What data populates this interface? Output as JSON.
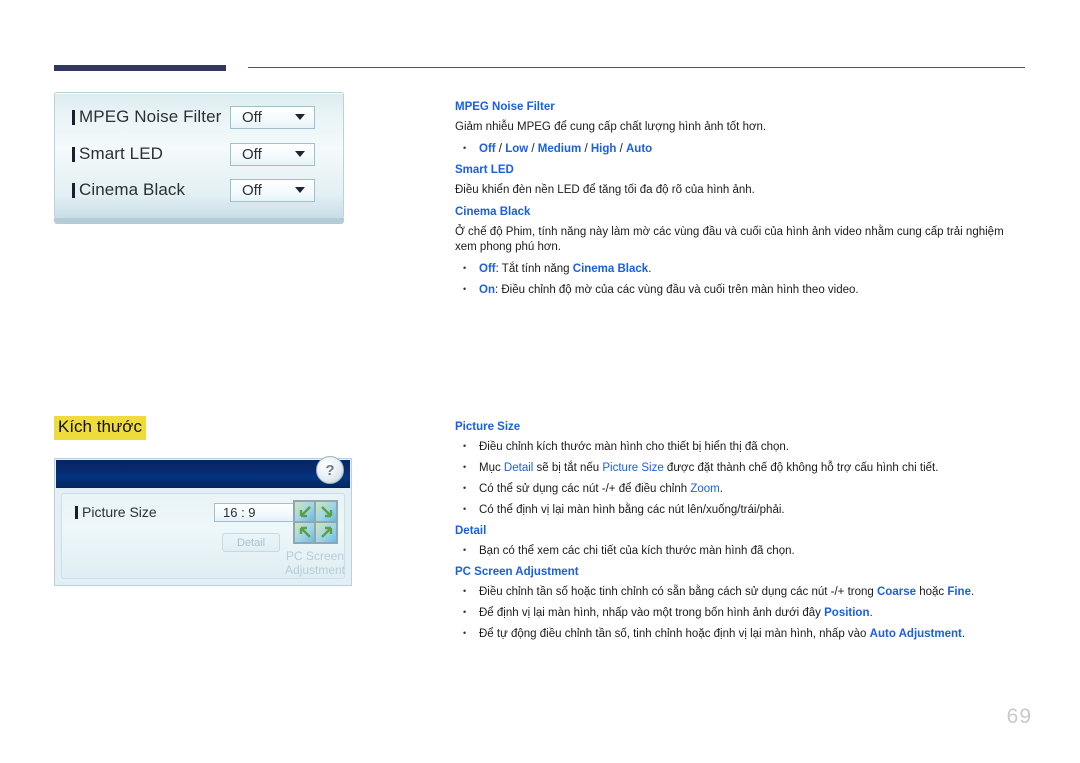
{
  "page": {
    "number": "69"
  },
  "osd_panel_picture": {
    "rows": [
      {
        "label": "MPEG Noise Filter",
        "value": "Off"
      },
      {
        "label": "Smart LED",
        "value": "Off"
      },
      {
        "label": "Cinema Black",
        "value": "Off"
      }
    ]
  },
  "section_heading": {
    "text": "Kích thước",
    "highlight_color": "#efdb3c"
  },
  "osd_panel_size": {
    "help_glyph": "?",
    "picture_size_label": "Picture Size",
    "picture_size_value": "16 : 9",
    "detail_button": "Detail",
    "pc_screen_adjustment_line1": "PC Screen",
    "pc_screen_adjustment_line2": "Adjustment"
  },
  "doc_top": {
    "sections": [
      {
        "title": "MPEG Noise Filter",
        "paragraphs": [
          "Giảm nhiễu MPEG để cung cấp chất lượng hình ảnh tốt hơn."
        ],
        "bullets_rich": [
          [
            {
              "t": "Off",
              "s": "b"
            },
            {
              "t": " / ",
              "s": "blk"
            },
            {
              "t": "Low",
              "s": "b"
            },
            {
              "t": " / ",
              "s": "blk"
            },
            {
              "t": "Medium",
              "s": "b"
            },
            {
              "t": " / ",
              "s": "blk"
            },
            {
              "t": "High",
              "s": "b"
            },
            {
              "t": " / ",
              "s": "blk"
            },
            {
              "t": "Auto",
              "s": "b"
            }
          ]
        ]
      },
      {
        "title": "Smart LED",
        "paragraphs": [
          "Điều khiển đèn nền LED để tăng tối đa độ rõ của hình ảnh."
        ],
        "bullets_rich": []
      },
      {
        "title": "Cinema Black",
        "paragraphs": [
          "Ở chế độ Phim, tính năng này làm mờ các vùng đầu và cuối của hình ảnh video nhằm cung cấp trải nghiệm xem phong phú hơn."
        ],
        "bullets_rich": [
          [
            {
              "t": "Off",
              "s": "b"
            },
            {
              "t": ": Tắt tính năng ",
              "s": "blk"
            },
            {
              "t": "Cinema Black",
              "s": "b"
            },
            {
              "t": ".",
              "s": "blk"
            }
          ],
          [
            {
              "t": "On",
              "s": "b"
            },
            {
              "t": ": Điều chỉnh độ mờ của các vùng đầu và cuối trên màn hình theo video.",
              "s": "blk"
            }
          ]
        ]
      }
    ]
  },
  "doc_bottom": {
    "sections": [
      {
        "title": "Picture Size",
        "paragraphs": [],
        "bullets_rich": [
          [
            {
              "t": "Điều chỉnh kích thước màn hình cho thiết bị hiển thị đã chọn.",
              "s": "blk"
            }
          ],
          [
            {
              "t": "Mục ",
              "s": "blk"
            },
            {
              "t": "Detail",
              "s": "bn"
            },
            {
              "t": " sẽ bị tắt nếu ",
              "s": "blk"
            },
            {
              "t": "Picture Size",
              "s": "bn"
            },
            {
              "t": " được đặt thành chế độ không hỗ trợ cấu hình chi tiết.",
              "s": "blk"
            }
          ],
          [
            {
              "t": "Có thể sử dụng các nút -/+ để điều chỉnh ",
              "s": "blk"
            },
            {
              "t": "Zoom",
              "s": "bn"
            },
            {
              "t": ".",
              "s": "blk"
            }
          ],
          [
            {
              "t": "Có thể định vị lại màn hình bằng các nút lên/xuống/trái/phải.",
              "s": "blk"
            }
          ]
        ]
      },
      {
        "title": "Detail",
        "paragraphs": [],
        "bullets_rich": [
          [
            {
              "t": "Bạn có thể xem các chi tiết của kích thước màn hình đã chọn.",
              "s": "blk"
            }
          ]
        ]
      },
      {
        "title": "PC Screen Adjustment",
        "paragraphs": [],
        "bullets_rich": [
          [
            {
              "t": "Điều chỉnh tần số hoặc tinh chỉnh có sẵn bằng cách sử dụng các nút -/+ trong ",
              "s": "blk"
            },
            {
              "t": "Coarse",
              "s": "b"
            },
            {
              "t": " hoặc ",
              "s": "blk"
            },
            {
              "t": "Fine",
              "s": "b"
            },
            {
              "t": ".",
              "s": "blk"
            }
          ],
          [
            {
              "t": "Để định vị lại màn hình, nhấp vào một trong bốn hình ảnh dưới đây ",
              "s": "blk"
            },
            {
              "t": "Position",
              "s": "b"
            },
            {
              "t": ".",
              "s": "blk"
            }
          ],
          [
            {
              "t": "Để tự động điều chỉnh tần số, tinh chỉnh hoặc định vị lại màn hình, nhấp vào ",
              "s": "blk"
            },
            {
              "t": "Auto Adjustment",
              "s": "b"
            },
            {
              "t": ".",
              "s": "blk"
            }
          ]
        ]
      }
    ]
  }
}
